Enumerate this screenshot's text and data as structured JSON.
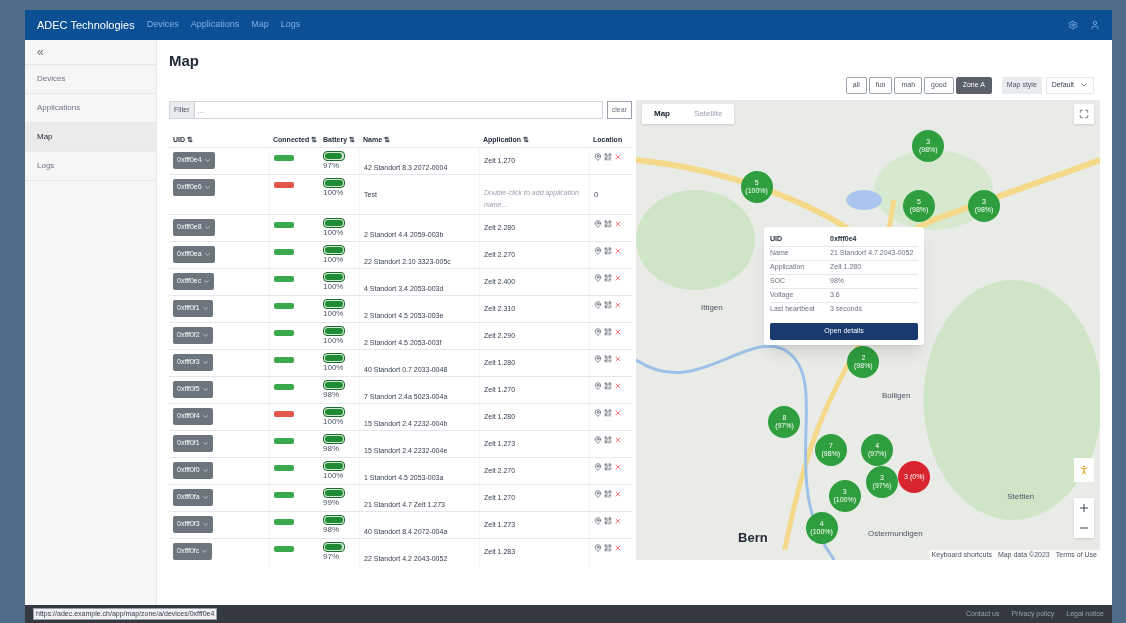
{
  "navbar": {
    "brand": "ADEC Technologies",
    "links": [
      "Devices",
      "Applications",
      "Map",
      "Logs"
    ]
  },
  "sidebar": {
    "back": "«",
    "items": [
      {
        "label": "Devices",
        "selected": false
      },
      {
        "label": "Applications",
        "selected": false
      },
      {
        "label": "Map",
        "selected": true
      },
      {
        "label": "Logs",
        "selected": false
      }
    ]
  },
  "page_title": "Map",
  "zone_buttons": [
    {
      "label": "all",
      "selected": false
    },
    {
      "label": "fun",
      "selected": false
    },
    {
      "label": "mah",
      "selected": false
    },
    {
      "label": "good",
      "selected": false
    },
    {
      "label": "Zone A",
      "selected": true
    }
  ],
  "map_style": {
    "label": "Map style",
    "value": "Default"
  },
  "filter": {
    "label": "Filter",
    "placeholder": "...",
    "clear": "clear"
  },
  "table": {
    "columns": [
      "UID ⇅",
      "Connected ⇅",
      "Battery ⇅",
      "Name ⇅",
      "Application ⇅",
      "Location"
    ],
    "rows": [
      {
        "uid": "0xfff0e4",
        "connected": true,
        "level": 0.97,
        "battery": "97%",
        "name": "42 Standort 8.3 2072-0004",
        "application": "Zelt 1.270",
        "application_empty": false,
        "location_icons": true
      },
      {
        "uid": "0xfff0e6",
        "connected": false,
        "level": 1,
        "battery": "100%",
        "name": "Test",
        "application": "Double-click to add application name...",
        "application_empty": true,
        "location_icons": false,
        "location": "0"
      },
      {
        "uid": "0xfff0e8",
        "connected": true,
        "level": 1,
        "battery": "100%",
        "name": "2 Standort 4.4 2059-003b",
        "application": "Zelt 2.280",
        "application_empty": false,
        "location_icons": true
      },
      {
        "uid": "0xfff0ea",
        "connected": true,
        "level": 1,
        "battery": "100%",
        "name": "22 Standort 2.10 3323-005c",
        "application": "Zelt 2.270",
        "application_empty": false,
        "location_icons": true
      },
      {
        "uid": "0xfff0ec",
        "connected": true,
        "level": 1,
        "battery": "100%",
        "name": "4 Standort 3.4 2053-003d",
        "application": "Zelt 2.400",
        "application_empty": false,
        "location_icons": true
      },
      {
        "uid": "0xfff0f1",
        "connected": true,
        "level": 1,
        "battery": "100%",
        "name": "2 Standort 4.5 2053-003e",
        "application": "Zelt 2.310",
        "application_empty": false,
        "location_icons": true
      },
      {
        "uid": "0xfff0f2",
        "connected": true,
        "level": 1,
        "battery": "100%",
        "name": "2 Standort 4.5 2053-003f",
        "application": "Zelt 2.290",
        "application_empty": false,
        "location_icons": true
      },
      {
        "uid": "0xfff0f3",
        "connected": true,
        "level": 1,
        "battery": "100%",
        "name": "40 Standort 0.7 2033-0048",
        "application": "Zelt 1.280",
        "application_empty": false,
        "location_icons": true
      },
      {
        "uid": "0xfff0f5",
        "connected": true,
        "level": 0.98,
        "battery": "98%",
        "name": "7 Standort 2.4a 5023-004a",
        "application": "Zelt 1.270",
        "application_empty": false,
        "location_icons": true
      },
      {
        "uid": "0xfff0f4",
        "connected": false,
        "level": 1,
        "battery": "100%",
        "name": "15 Standort 2.4 2232-004b",
        "application": "Zelt 1.280",
        "application_empty": false,
        "location_icons": true
      },
      {
        "uid": "0xfff0f1",
        "connected": true,
        "level": 0.98,
        "battery": "98%",
        "name": "15 Standort 2.4 2232-004e",
        "application": "Zelt 1.273",
        "application_empty": false,
        "location_icons": true
      },
      {
        "uid": "0xfff0f0",
        "connected": true,
        "level": 1,
        "battery": "100%",
        "name": "1 Standort 4.5 2053-003a",
        "application": "Zelt 2.270",
        "application_empty": false,
        "location_icons": true
      },
      {
        "uid": "0xfff0fa",
        "connected": true,
        "level": 0.99,
        "battery": "99%",
        "name": "21 Standort 4.7 Zelt 1.273",
        "application": "Zelt 1.270",
        "application_empty": false,
        "location_icons": true
      },
      {
        "uid": "0xfff0f3",
        "connected": true,
        "level": 0.98,
        "battery": "98%",
        "name": "40 Standort 8.4 2072-004a",
        "application": "Zelt 1.273",
        "application_empty": false,
        "location_icons": true
      },
      {
        "uid": "0xfff0fc",
        "connected": true,
        "level": 0.97,
        "battery": "97%",
        "name": "22 Standort 4.2 2043-0052",
        "application": "Zelt 1.283",
        "application_empty": false,
        "location_icons": true
      }
    ]
  },
  "map": {
    "tabs": [
      {
        "label": "Map",
        "selected": true
      },
      {
        "label": "Satellite",
        "selected": false
      }
    ],
    "places": [
      {
        "label": "Ittigen",
        "major": false
      },
      {
        "label": "Bolligen",
        "major": false
      },
      {
        "label": "Ostermundigen",
        "major": false
      },
      {
        "label": "Stettlen",
        "major": false
      },
      {
        "label": "Bern",
        "major": true
      }
    ],
    "clusters": [
      {
        "count": "3",
        "share": "(98%)",
        "color": "#2e9e3e"
      },
      {
        "count": "5",
        "share": "(100%)",
        "color": "#2e9e3e"
      },
      {
        "count": "5",
        "share": "(98%)",
        "color": "#2e9e3e"
      },
      {
        "count": "3",
        "share": "(98%)",
        "color": "#2e9e3e"
      },
      {
        "count": "2",
        "share": "(98%)",
        "color": "#2e9e3e"
      },
      {
        "count": "8",
        "share": "(97%)",
        "color": "#2e9e3e"
      },
      {
        "count": "7",
        "share": "(98%)",
        "color": "#2e9e3e"
      },
      {
        "count": "4",
        "share": "(97%)",
        "color": "#2e9e3e"
      },
      {
        "count": "3",
        "share": "(97%)",
        "color": "#2e9e3e"
      },
      {
        "count": "3 (0%)",
        "color": "#d9252f"
      },
      {
        "count": "3",
        "share": "(100%)",
        "color": "#2e9e3e"
      },
      {
        "count": "4",
        "share": "(100%)",
        "color": "#2e9e3e"
      }
    ],
    "popup": {
      "rows": [
        [
          "UID",
          "0xfff0e4"
        ],
        [
          "Name",
          "21 Standort 4.7 2043-0052"
        ],
        [
          "Application",
          "Zelt 1.280"
        ],
        [
          "SOC",
          "98%"
        ],
        [
          "Voltage",
          "3.6"
        ],
        [
          "Last heartbeat",
          "3 seconds"
        ]
      ],
      "button": "Open details"
    },
    "attribution": [
      "Keyboard shortcuts",
      "Map data ©2023",
      "Terms of Use"
    ]
  },
  "footer": {
    "links": [
      "Contact us",
      "Privacy policy",
      "Legal notice"
    ]
  },
  "status_url": "https://adec.example.ch/app/map/zone/a/devices/0xfff0e4"
}
